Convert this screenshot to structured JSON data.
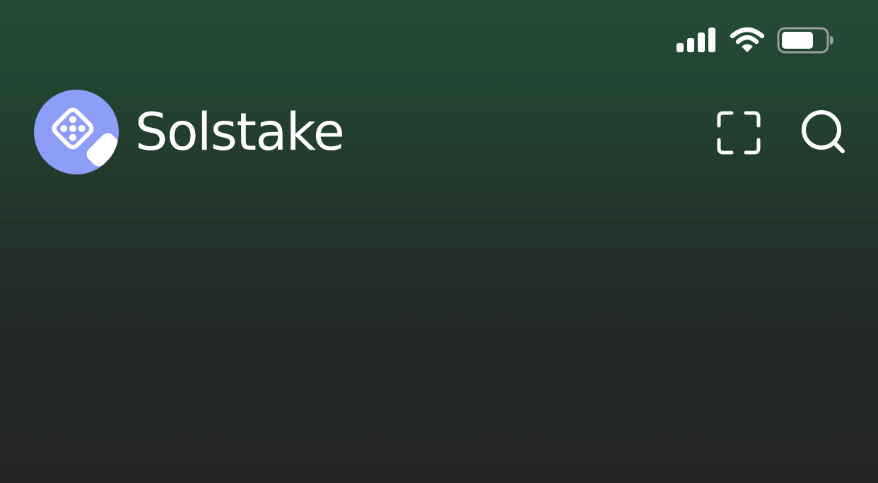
{
  "status_bar": {
    "signal_icon": "cellular-signal-icon",
    "wifi_icon": "wifi-icon",
    "battery_icon": "battery-icon"
  },
  "header": {
    "logo_icon": "dice-icon",
    "brand_name": "Solstake",
    "actions": [
      {
        "icon": "scan-icon"
      },
      {
        "icon": "search-icon"
      }
    ]
  },
  "colors": {
    "background_top": "#234c36",
    "background_bottom": "#232525",
    "logo_circle": "#8e9df8",
    "text": "#ffffff"
  }
}
